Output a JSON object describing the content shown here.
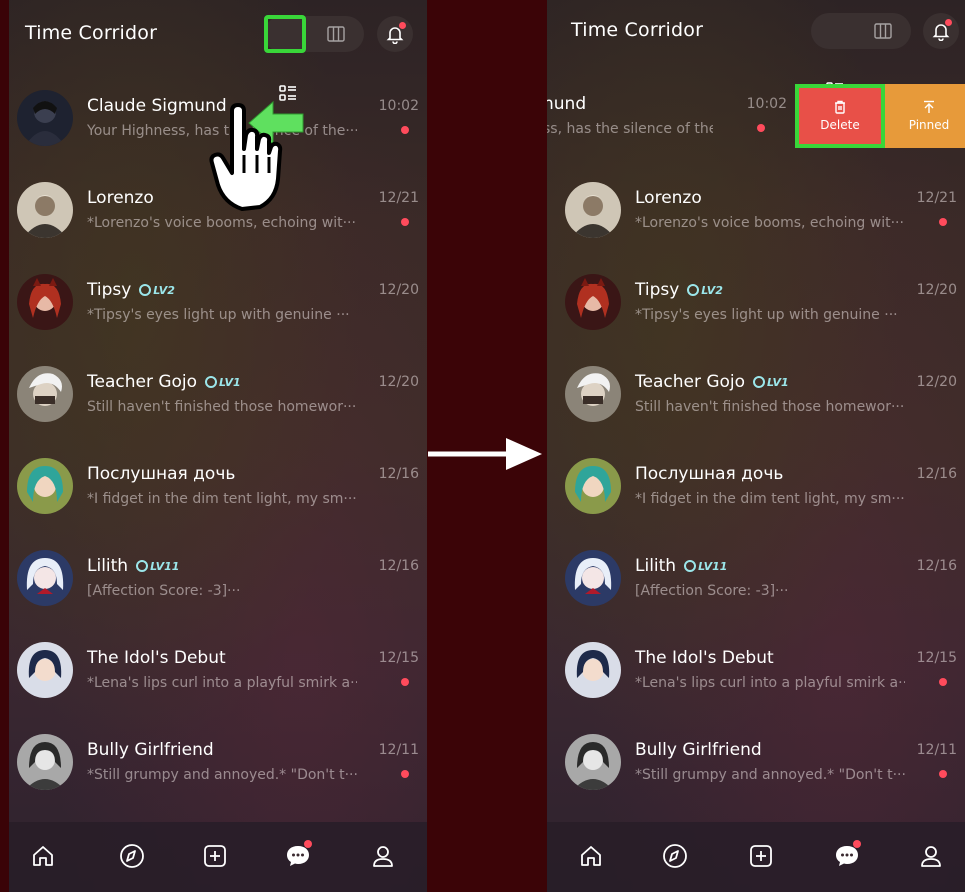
{
  "app": {
    "title": "Time Corridor"
  },
  "swipe_actions": {
    "delete_label": "Delete",
    "pinned_label": "Pinned"
  },
  "chats": [
    {
      "name": "Claude Sigmund",
      "preview": "Your Highness, has the silence of the···",
      "time": "10:02",
      "unread": true,
      "level": ""
    },
    {
      "name": "Lorenzo",
      "preview": "*Lorenzo's voice booms, echoing wit···",
      "time": "12/21",
      "unread": true,
      "level": ""
    },
    {
      "name": "Tipsy",
      "preview": "*Tipsy's eyes light up with genuine ···",
      "time": "12/20",
      "unread": false,
      "level": "LV2"
    },
    {
      "name": "Teacher Gojo",
      "preview": "Still haven't finished those homewor···",
      "time": "12/20",
      "unread": false,
      "level": "LV1"
    },
    {
      "name": "Послушная дочь",
      "preview": "*I fidget in the dim tent light, my sm···",
      "time": "12/16",
      "unread": false,
      "level": ""
    },
    {
      "name": "Lilith",
      "preview": "[Affection Score: -3]···",
      "time": "12/16",
      "unread": false,
      "level": "LV11"
    },
    {
      "name": "The Idol's Debut",
      "preview": "*Lena's lips curl into a playful smirk a···",
      "time": "12/15",
      "unread": true,
      "level": ""
    },
    {
      "name": "Bully Girlfriend",
      "preview": "*Still grumpy and annoyed.* \"Don't t···",
      "time": "12/11",
      "unread": true,
      "level": ""
    }
  ],
  "right_first_row": {
    "name_fragment": "nund",
    "preview_fragment": "ss, has the silence of the···",
    "time": "10:02"
  },
  "icons": {
    "nav": [
      "home-icon",
      "compass-icon",
      "add-icon",
      "chat-icon",
      "profile-icon"
    ],
    "header": [
      "list-view-icon",
      "grid-view-icon",
      "bell-icon"
    ]
  },
  "colors": {
    "highlight": "#39d639",
    "delete": "#e85048",
    "pinned": "#e79a3a",
    "unread": "#ff4b5c",
    "level_badge": "#9be6ea"
  }
}
